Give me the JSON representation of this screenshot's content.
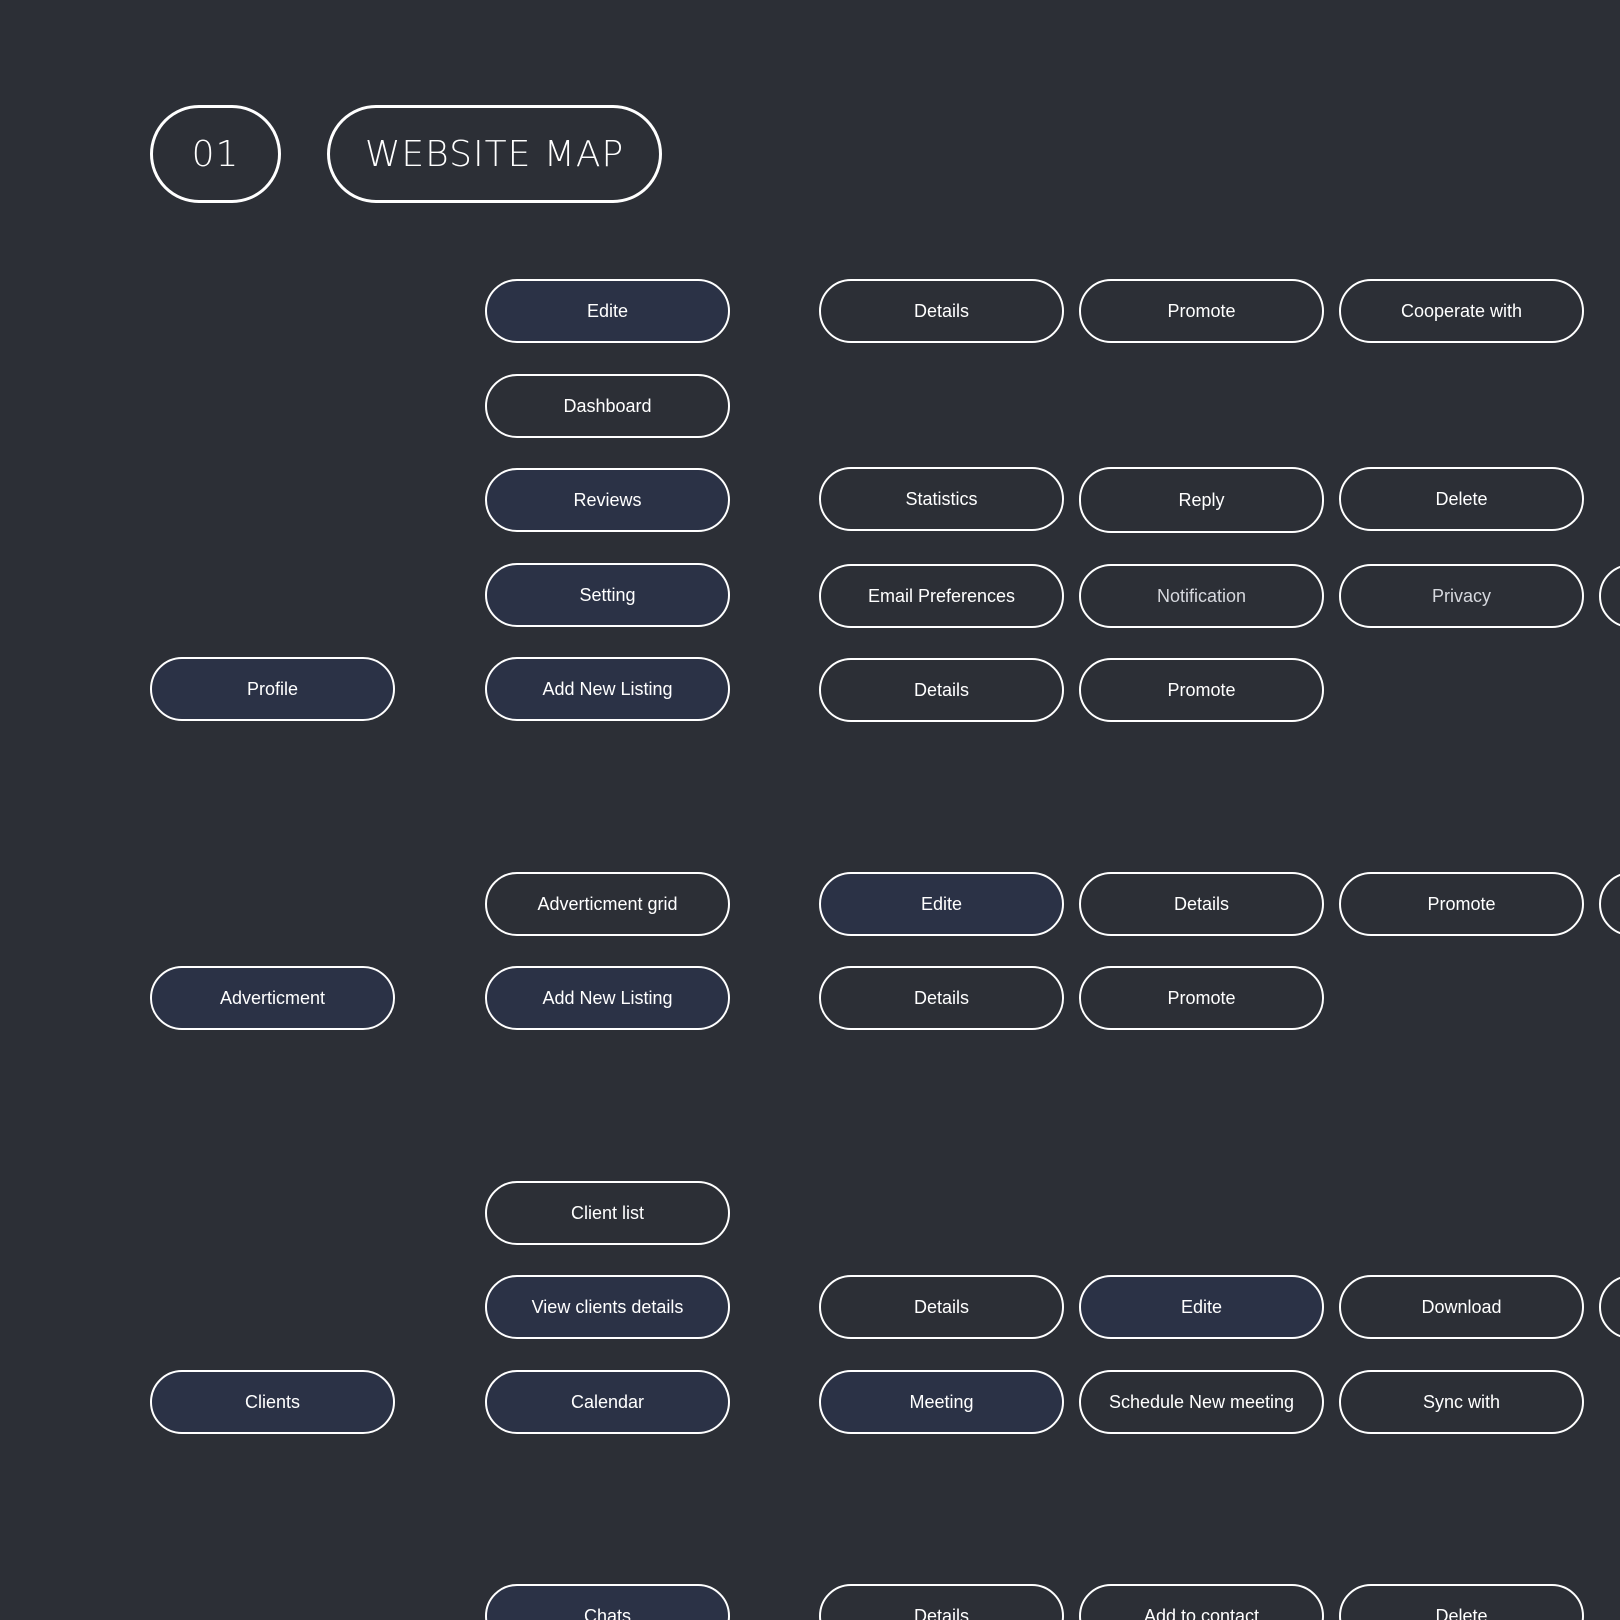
{
  "header": {
    "number": "01",
    "title": "WEBSITE MAP"
  },
  "colors": {
    "background": "#2c2f36",
    "filled_node": "#2b3246",
    "stroke": "#ffffff"
  },
  "sections": {
    "profile": {
      "root": "Profile",
      "edite": "Edite",
      "edite_children": [
        "Details",
        "Promote",
        "Cooperate with"
      ],
      "dashboard": "Dashboard",
      "reviews": "Reviews",
      "reviews_children": [
        "Statistics",
        "Reply",
        "Delete"
      ],
      "setting": "Setting",
      "setting_children": [
        "Email Preferences",
        "Notification",
        "Privacy"
      ],
      "add_new_listing": "Add New Listing",
      "add_new_listing_children": [
        "Details",
        "Promote"
      ]
    },
    "advertisement": {
      "root": "Adverticment",
      "grid": "Adverticment grid",
      "grid_children": [
        "Edite",
        "Details",
        "Promote"
      ],
      "add_new_listing": "Add New Listing",
      "add_new_listing_children": [
        "Details",
        "Promote"
      ]
    },
    "clients": {
      "root": "Clients",
      "client_list": "Client list",
      "view_details": "View clients details",
      "view_details_children": [
        "Details",
        "Edite",
        "Download"
      ],
      "calendar": "Calendar",
      "calendar_children": [
        "Meeting",
        "Schedule New meeting",
        "Sync with"
      ]
    },
    "chats": {
      "chats": "Chats",
      "chats_children": [
        "Details",
        "Add to contact",
        "Delete"
      ]
    }
  }
}
